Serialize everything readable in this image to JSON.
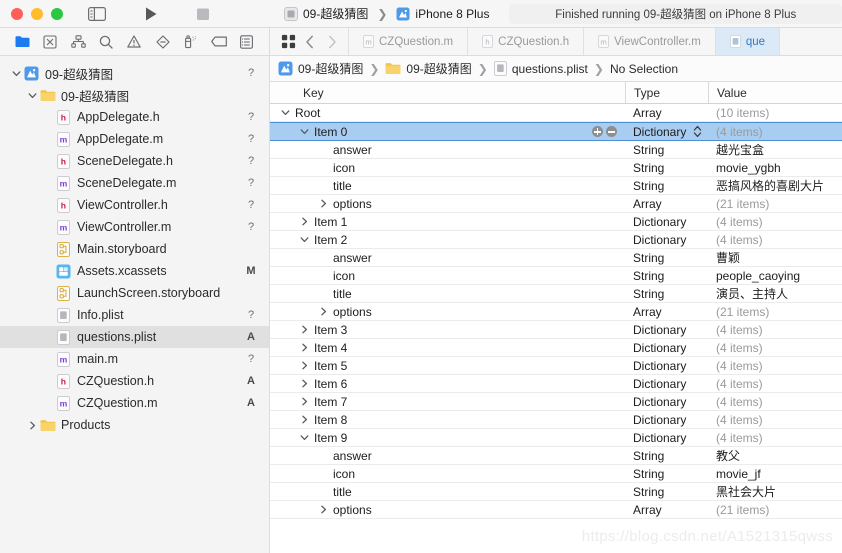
{
  "toolbar": {
    "window_controls": [
      "close",
      "minimize",
      "zoom"
    ],
    "panel_toggle_icon": "sidebar-toggle-icon",
    "run_label": "Run",
    "stop_label": "Stop",
    "scheme_name": "09-超级猜图",
    "destination_name": "iPhone 8 Plus",
    "status_text": "Finished running 09-超级猜图 on iPhone 8 Plus"
  },
  "navigator_filter": {
    "icons": [
      {
        "name": "project-navigator-icon",
        "active": true
      },
      {
        "name": "source-control-navigator-icon",
        "active": false
      },
      {
        "name": "symbol-navigator-icon",
        "active": false
      },
      {
        "name": "find-navigator-icon",
        "active": false
      },
      {
        "name": "issue-navigator-icon",
        "active": false
      },
      {
        "name": "test-navigator-icon",
        "active": false
      },
      {
        "name": "debug-navigator-icon",
        "active": false
      },
      {
        "name": "breakpoint-navigator-icon",
        "active": false
      },
      {
        "name": "report-navigator-icon",
        "active": false
      }
    ]
  },
  "tabs": {
    "back_label": "Back",
    "forward_label": "Forward",
    "items": [
      {
        "label": "CZQuestion.m",
        "kind": "m",
        "active": false
      },
      {
        "label": "CZQuestion.h",
        "kind": "h",
        "active": false
      },
      {
        "label": "ViewController.m",
        "kind": "m",
        "active": false
      },
      {
        "label": "que",
        "kind": "plist",
        "active": true
      }
    ]
  },
  "sidebar": {
    "items": [
      {
        "label": "09-超级猜图",
        "icon": "xcode-project-icon",
        "indent": 0,
        "twisty": "down",
        "status": "?"
      },
      {
        "label": "09-超级猜图",
        "icon": "folder-icon",
        "indent": 1,
        "twisty": "down",
        "status": ""
      },
      {
        "label": "AppDelegate.h",
        "icon": "header-file-icon",
        "indent": 2,
        "twisty": "none",
        "status": "?"
      },
      {
        "label": "AppDelegate.m",
        "icon": "source-file-icon",
        "indent": 2,
        "twisty": "none",
        "status": "?"
      },
      {
        "label": "SceneDelegate.h",
        "icon": "header-file-icon",
        "indent": 2,
        "twisty": "none",
        "status": "?"
      },
      {
        "label": "SceneDelegate.m",
        "icon": "source-file-icon",
        "indent": 2,
        "twisty": "none",
        "status": "?"
      },
      {
        "label": "ViewController.h",
        "icon": "header-file-icon",
        "indent": 2,
        "twisty": "none",
        "status": "?"
      },
      {
        "label": "ViewController.m",
        "icon": "source-file-icon",
        "indent": 2,
        "twisty": "none",
        "status": "?"
      },
      {
        "label": "Main.storyboard",
        "icon": "storyboard-icon",
        "indent": 2,
        "twisty": "none",
        "status": ""
      },
      {
        "label": "Assets.xcassets",
        "icon": "assets-icon",
        "indent": 2,
        "twisty": "none",
        "status": "M"
      },
      {
        "label": "LaunchScreen.storyboard",
        "icon": "storyboard-icon",
        "indent": 2,
        "twisty": "none",
        "status": ""
      },
      {
        "label": "Info.plist",
        "icon": "plist-icon",
        "indent": 2,
        "twisty": "none",
        "status": "?"
      },
      {
        "label": "questions.plist",
        "icon": "plist-icon",
        "indent": 2,
        "twisty": "none",
        "status": "A",
        "selected": true
      },
      {
        "label": "main.m",
        "icon": "source-file-icon",
        "indent": 2,
        "twisty": "none",
        "status": "?"
      },
      {
        "label": "CZQuestion.h",
        "icon": "header-file-icon",
        "indent": 2,
        "twisty": "none",
        "status": "A"
      },
      {
        "label": "CZQuestion.m",
        "icon": "source-file-icon",
        "indent": 2,
        "twisty": "none",
        "status": "A"
      },
      {
        "label": "Products",
        "icon": "folder-icon",
        "indent": 1,
        "twisty": "right",
        "status": ""
      }
    ]
  },
  "jumpbar": {
    "crumbs": [
      {
        "label": "09-超级猜图",
        "icon": "xcode-project-icon"
      },
      {
        "label": "09-超级猜图",
        "icon": "folder-icon"
      },
      {
        "label": "questions.plist",
        "icon": "plist-icon"
      },
      {
        "label": "No Selection",
        "icon": "none"
      }
    ]
  },
  "plist": {
    "headers": {
      "key": "Key",
      "type": "Type",
      "value": "Value"
    },
    "rows": [
      {
        "key": "Root",
        "indent": 0,
        "twisty": "down",
        "type": "Array",
        "value": "(10 items)",
        "muted": true
      },
      {
        "key": "Item 0",
        "indent": 1,
        "twisty": "down",
        "type": "Dictionary",
        "value": "(4 items)",
        "muted": true,
        "selected": true,
        "controls": true
      },
      {
        "key": "answer",
        "indent": 2,
        "twisty": "none",
        "type": "String",
        "value": "越光宝盒",
        "muted": false
      },
      {
        "key": "icon",
        "indent": 2,
        "twisty": "none",
        "type": "String",
        "value": "movie_ygbh",
        "muted": false
      },
      {
        "key": "title",
        "indent": 2,
        "twisty": "none",
        "type": "String",
        "value": "恶搞风格的喜剧大片",
        "muted": false
      },
      {
        "key": "options",
        "indent": 2,
        "twisty": "right",
        "type": "Array",
        "value": "(21 items)",
        "muted": true
      },
      {
        "key": "Item 1",
        "indent": 1,
        "twisty": "right",
        "type": "Dictionary",
        "value": "(4 items)",
        "muted": true
      },
      {
        "key": "Item 2",
        "indent": 1,
        "twisty": "down",
        "type": "Dictionary",
        "value": "(4 items)",
        "muted": true
      },
      {
        "key": "answer",
        "indent": 2,
        "twisty": "none",
        "type": "String",
        "value": "曹颖",
        "muted": false
      },
      {
        "key": "icon",
        "indent": 2,
        "twisty": "none",
        "type": "String",
        "value": "people_caoying",
        "muted": false
      },
      {
        "key": "title",
        "indent": 2,
        "twisty": "none",
        "type": "String",
        "value": "演员、主持人",
        "muted": false
      },
      {
        "key": "options",
        "indent": 2,
        "twisty": "right",
        "type": "Array",
        "value": "(21 items)",
        "muted": true
      },
      {
        "key": "Item 3",
        "indent": 1,
        "twisty": "right",
        "type": "Dictionary",
        "value": "(4 items)",
        "muted": true
      },
      {
        "key": "Item 4",
        "indent": 1,
        "twisty": "right",
        "type": "Dictionary",
        "value": "(4 items)",
        "muted": true
      },
      {
        "key": "Item 5",
        "indent": 1,
        "twisty": "right",
        "type": "Dictionary",
        "value": "(4 items)",
        "muted": true
      },
      {
        "key": "Item 6",
        "indent": 1,
        "twisty": "right",
        "type": "Dictionary",
        "value": "(4 items)",
        "muted": true
      },
      {
        "key": "Item 7",
        "indent": 1,
        "twisty": "right",
        "type": "Dictionary",
        "value": "(4 items)",
        "muted": true
      },
      {
        "key": "Item 8",
        "indent": 1,
        "twisty": "right",
        "type": "Dictionary",
        "value": "(4 items)",
        "muted": true
      },
      {
        "key": "Item 9",
        "indent": 1,
        "twisty": "down",
        "type": "Dictionary",
        "value": "(4 items)",
        "muted": true
      },
      {
        "key": "answer",
        "indent": 2,
        "twisty": "none",
        "type": "String",
        "value": "教父",
        "muted": false
      },
      {
        "key": "icon",
        "indent": 2,
        "twisty": "none",
        "type": "String",
        "value": "movie_jf",
        "muted": false
      },
      {
        "key": "title",
        "indent": 2,
        "twisty": "none",
        "type": "String",
        "value": "黑社会大片",
        "muted": false
      },
      {
        "key": "options",
        "indent": 2,
        "twisty": "right",
        "type": "Array",
        "value": "(21 items)",
        "muted": true
      }
    ]
  },
  "watermark": "https://blog.csdn.net/A1521315qwss",
  "colors": {
    "selection_blue": "#a9cdf0",
    "selection_border": "#4c8fd4",
    "active_tab_blue": "#dceaf8",
    "accent": "#3478c6",
    "header_icon_blue": "#1a7cf0",
    "folder_yellow": "#f5c54a"
  }
}
